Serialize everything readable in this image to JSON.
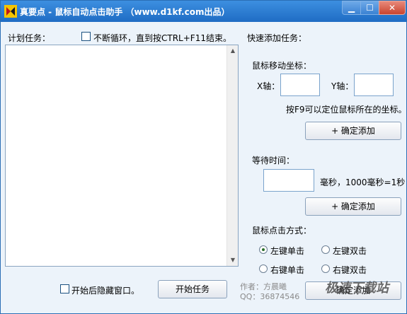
{
  "window": {
    "title": "真要点 - 鼠标自动点击助手 （www.d1kf.com出品）",
    "min_icon": "minimize-icon",
    "max_icon": "maximize-icon",
    "close_icon": "close-icon"
  },
  "left": {
    "plan_label": "计划任务：",
    "loop_label": "不断循环，直到按CTRL+F11结束。",
    "loop_checked": false,
    "hide_label": "开始后隐藏窗口。",
    "hide_checked": false,
    "start_button": "开始任务",
    "author": "作者：方晨曦",
    "qq": "QQ：36874546"
  },
  "right": {
    "quick_add": "快速添加任务：",
    "coord_label": "鼠标移动坐标：",
    "x_label": "X轴：",
    "y_label": "Y轴：",
    "x_value": "",
    "y_value": "",
    "f9_hint": "按F9可以定位鼠标所在的坐标。",
    "add_button_1": "+ 确定添加",
    "wait_label": "等待时间：",
    "wait_value": "",
    "wait_unit": "毫秒，1000毫秒=1秒",
    "add_button_2": "+ 确定添加",
    "click_label": "鼠标点击方式：",
    "left_single": "左键单击",
    "left_double": "左键双击",
    "right_single": "右键单击",
    "right_double": "右键双击",
    "selected_click": "左键单击",
    "add_button_3": "确定添加"
  },
  "watermark": "极速下载站",
  "colors": {
    "titlebar": "#2b7bd4",
    "background": "#ecf3fa",
    "close": "#c9442f"
  }
}
